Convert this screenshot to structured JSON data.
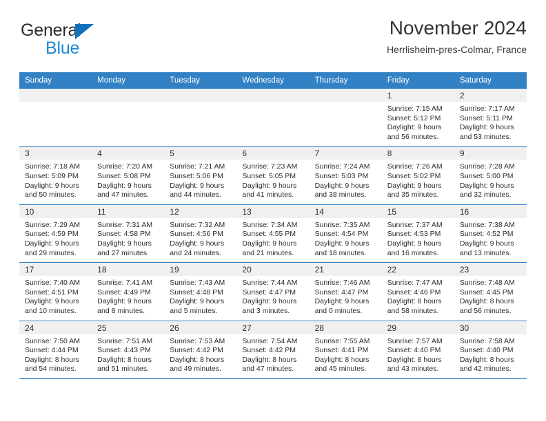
{
  "brand": {
    "name_part1": "General",
    "name_part2": "Blue",
    "logo_icon": "triangle-logo-icon",
    "colors": {
      "blue": "#1b87d4",
      "dark": "#2b2b2b",
      "triangle": "#1171ba"
    }
  },
  "header": {
    "title": "November 2024",
    "subtitle": "Herrlisheim-pres-Colmar, France"
  },
  "calendar": {
    "header_color": "#3281c4",
    "weekdays": [
      "Sunday",
      "Monday",
      "Tuesday",
      "Wednesday",
      "Thursday",
      "Friday",
      "Saturday"
    ],
    "weeks": [
      [
        {
          "day": "",
          "lines": [
            "",
            "",
            "",
            ""
          ]
        },
        {
          "day": "",
          "lines": [
            "",
            "",
            "",
            ""
          ]
        },
        {
          "day": "",
          "lines": [
            "",
            "",
            "",
            ""
          ]
        },
        {
          "day": "",
          "lines": [
            "",
            "",
            "",
            ""
          ]
        },
        {
          "day": "",
          "lines": [
            "",
            "",
            "",
            ""
          ]
        },
        {
          "day": "1",
          "lines": [
            "Sunrise: 7:15 AM",
            "Sunset: 5:12 PM",
            "Daylight: 9 hours",
            "and 56 minutes."
          ]
        },
        {
          "day": "2",
          "lines": [
            "Sunrise: 7:17 AM",
            "Sunset: 5:11 PM",
            "Daylight: 9 hours",
            "and 53 minutes."
          ]
        }
      ],
      [
        {
          "day": "3",
          "lines": [
            "Sunrise: 7:18 AM",
            "Sunset: 5:09 PM",
            "Daylight: 9 hours",
            "and 50 minutes."
          ]
        },
        {
          "day": "4",
          "lines": [
            "Sunrise: 7:20 AM",
            "Sunset: 5:08 PM",
            "Daylight: 9 hours",
            "and 47 minutes."
          ]
        },
        {
          "day": "5",
          "lines": [
            "Sunrise: 7:21 AM",
            "Sunset: 5:06 PM",
            "Daylight: 9 hours",
            "and 44 minutes."
          ]
        },
        {
          "day": "6",
          "lines": [
            "Sunrise: 7:23 AM",
            "Sunset: 5:05 PM",
            "Daylight: 9 hours",
            "and 41 minutes."
          ]
        },
        {
          "day": "7",
          "lines": [
            "Sunrise: 7:24 AM",
            "Sunset: 5:03 PM",
            "Daylight: 9 hours",
            "and 38 minutes."
          ]
        },
        {
          "day": "8",
          "lines": [
            "Sunrise: 7:26 AM",
            "Sunset: 5:02 PM",
            "Daylight: 9 hours",
            "and 35 minutes."
          ]
        },
        {
          "day": "9",
          "lines": [
            "Sunrise: 7:28 AM",
            "Sunset: 5:00 PM",
            "Daylight: 9 hours",
            "and 32 minutes."
          ]
        }
      ],
      [
        {
          "day": "10",
          "lines": [
            "Sunrise: 7:29 AM",
            "Sunset: 4:59 PM",
            "Daylight: 9 hours",
            "and 29 minutes."
          ]
        },
        {
          "day": "11",
          "lines": [
            "Sunrise: 7:31 AM",
            "Sunset: 4:58 PM",
            "Daylight: 9 hours",
            "and 27 minutes."
          ]
        },
        {
          "day": "12",
          "lines": [
            "Sunrise: 7:32 AM",
            "Sunset: 4:56 PM",
            "Daylight: 9 hours",
            "and 24 minutes."
          ]
        },
        {
          "day": "13",
          "lines": [
            "Sunrise: 7:34 AM",
            "Sunset: 4:55 PM",
            "Daylight: 9 hours",
            "and 21 minutes."
          ]
        },
        {
          "day": "14",
          "lines": [
            "Sunrise: 7:35 AM",
            "Sunset: 4:54 PM",
            "Daylight: 9 hours",
            "and 18 minutes."
          ]
        },
        {
          "day": "15",
          "lines": [
            "Sunrise: 7:37 AM",
            "Sunset: 4:53 PM",
            "Daylight: 9 hours",
            "and 16 minutes."
          ]
        },
        {
          "day": "16",
          "lines": [
            "Sunrise: 7:38 AM",
            "Sunset: 4:52 PM",
            "Daylight: 9 hours",
            "and 13 minutes."
          ]
        }
      ],
      [
        {
          "day": "17",
          "lines": [
            "Sunrise: 7:40 AM",
            "Sunset: 4:51 PM",
            "Daylight: 9 hours",
            "and 10 minutes."
          ]
        },
        {
          "day": "18",
          "lines": [
            "Sunrise: 7:41 AM",
            "Sunset: 4:49 PM",
            "Daylight: 9 hours",
            "and 8 minutes."
          ]
        },
        {
          "day": "19",
          "lines": [
            "Sunrise: 7:43 AM",
            "Sunset: 4:48 PM",
            "Daylight: 9 hours",
            "and 5 minutes."
          ]
        },
        {
          "day": "20",
          "lines": [
            "Sunrise: 7:44 AM",
            "Sunset: 4:47 PM",
            "Daylight: 9 hours",
            "and 3 minutes."
          ]
        },
        {
          "day": "21",
          "lines": [
            "Sunrise: 7:46 AM",
            "Sunset: 4:47 PM",
            "Daylight: 9 hours",
            "and 0 minutes."
          ]
        },
        {
          "day": "22",
          "lines": [
            "Sunrise: 7:47 AM",
            "Sunset: 4:46 PM",
            "Daylight: 8 hours",
            "and 58 minutes."
          ]
        },
        {
          "day": "23",
          "lines": [
            "Sunrise: 7:48 AM",
            "Sunset: 4:45 PM",
            "Daylight: 8 hours",
            "and 56 minutes."
          ]
        }
      ],
      [
        {
          "day": "24",
          "lines": [
            "Sunrise: 7:50 AM",
            "Sunset: 4:44 PM",
            "Daylight: 8 hours",
            "and 54 minutes."
          ]
        },
        {
          "day": "25",
          "lines": [
            "Sunrise: 7:51 AM",
            "Sunset: 4:43 PM",
            "Daylight: 8 hours",
            "and 51 minutes."
          ]
        },
        {
          "day": "26",
          "lines": [
            "Sunrise: 7:53 AM",
            "Sunset: 4:42 PM",
            "Daylight: 8 hours",
            "and 49 minutes."
          ]
        },
        {
          "day": "27",
          "lines": [
            "Sunrise: 7:54 AM",
            "Sunset: 4:42 PM",
            "Daylight: 8 hours",
            "and 47 minutes."
          ]
        },
        {
          "day": "28",
          "lines": [
            "Sunrise: 7:55 AM",
            "Sunset: 4:41 PM",
            "Daylight: 8 hours",
            "and 45 minutes."
          ]
        },
        {
          "day": "29",
          "lines": [
            "Sunrise: 7:57 AM",
            "Sunset: 4:40 PM",
            "Daylight: 8 hours",
            "and 43 minutes."
          ]
        },
        {
          "day": "30",
          "lines": [
            "Sunrise: 7:58 AM",
            "Sunset: 4:40 PM",
            "Daylight: 8 hours",
            "and 42 minutes."
          ]
        }
      ]
    ]
  }
}
